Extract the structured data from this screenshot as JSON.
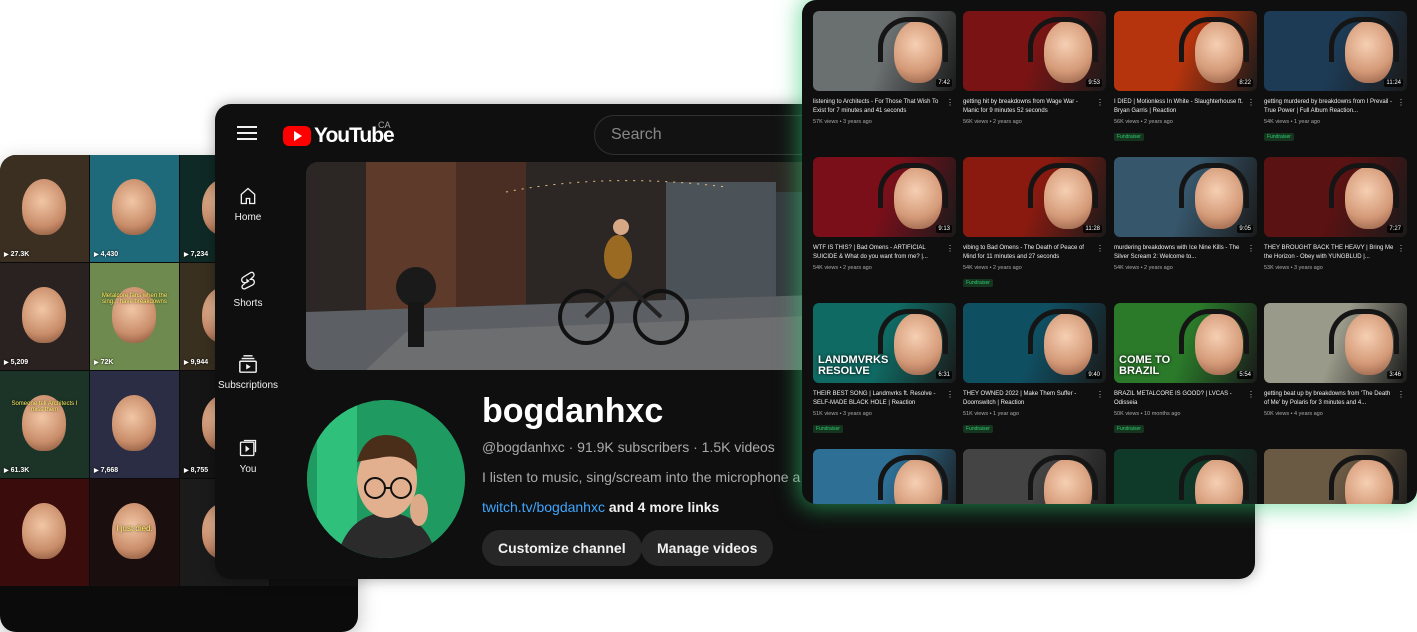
{
  "shorts": {
    "tiles": [
      {
        "views": "27.3K",
        "bg": "#3b2f22"
      },
      {
        "views": "4,430",
        "bg": "#1f6a7a"
      },
      {
        "views": "7,234",
        "bg": "#0f2a26"
      },
      {
        "views": "",
        "bg": "#101010"
      },
      {
        "views": "5,209",
        "bg": "#2a2220"
      },
      {
        "views": "72K",
        "bg": "#6f8a4e",
        "caption": "Metalcore fans when the sing... have breakdowns"
      },
      {
        "views": "9,944",
        "bg": "#3a3020"
      },
      {
        "views": "",
        "bg": "#101010"
      },
      {
        "views": "61.3K",
        "bg": "#1c3328",
        "caption": "Someone tell Architects I miss them"
      },
      {
        "views": "7,668",
        "bg": "#2a2d44"
      },
      {
        "views": "8,755",
        "bg": "#151515"
      },
      {
        "views": "",
        "bg": "#101010"
      },
      {
        "views": "",
        "bg": "#3a0c0c"
      },
      {
        "views": "",
        "bg": "#1a0e0e",
        "caption2": "I just died."
      },
      {
        "views": "",
        "bg": "#1b1b1b"
      },
      {
        "views": "",
        "bg": "#101010"
      }
    ]
  },
  "app": {
    "brand": "YouTube",
    "country_code": "CA",
    "search_placeholder": "Search"
  },
  "sidebar": [
    {
      "label": "Home",
      "icon": "home-icon"
    },
    {
      "label": "Shorts",
      "icon": "shorts-icon"
    },
    {
      "label": "Subscriptions",
      "icon": "subscriptions-icon"
    },
    {
      "label": "You",
      "icon": "you-icon"
    }
  ],
  "channel": {
    "name": "bogdanhxc",
    "meta": "@bogdanhxc · 91.9K subscribers · 1.5K videos",
    "description": "I listen to music, sing/scream into the microphone a",
    "link": "twitch.tv/bogdanhxc",
    "more_links": " and 4 more links",
    "customize_label": "Customize channel",
    "manage_label": "Manage videos"
  },
  "videos": [
    {
      "title": "listening to Architects - For Those That Wish To Exist for 7 minutes and 41 seconds",
      "stats": "57K views • 3 years ago",
      "duration": "7:42",
      "fundraiser": false,
      "color": "#6a6f70"
    },
    {
      "title": "getting hit by breakdowns from Wage War - Manic for 9 minutes 52 seconds",
      "stats": "56K views • 2 years ago",
      "duration": "9:53",
      "fundraiser": false,
      "color": "#7a1414"
    },
    {
      "title": "I DIED | Motionless In White - Slaughterhouse ft. Bryan Garris | Reaction",
      "stats": "56K views • 2 years ago",
      "duration": "8:22",
      "fundraiser": true,
      "color": "#b5340d"
    },
    {
      "title": "getting murdered by breakdowns from I Prevail - True Power | Full Album Reaction...",
      "stats": "54K views • 1 year ago",
      "duration": "11:24",
      "fundraiser": true,
      "color": "#1d3b55"
    },
    {
      "title": "WTF IS THIS? | Bad Omens - ARTIFICIAL SUICIDE & What do you want from me? |...",
      "stats": "54K views • 2 years ago",
      "duration": "9:13",
      "fundraiser": false,
      "color": "#7a0f1a"
    },
    {
      "title": "vibing to Bad Omens - The Death of Peace of Mind for 11 minutes and 27 seconds",
      "stats": "54K views • 2 years ago",
      "duration": "11:28",
      "fundraiser": true,
      "color": "#8a1a10"
    },
    {
      "title": "murdering breakdowns with Ice Nine Kills - The Silver Scream 2: Welcome to...",
      "stats": "54K views • 2 years ago",
      "duration": "9:05",
      "fundraiser": false,
      "color": "#36566b"
    },
    {
      "title": "THEY BROUGHT BACK THE HEAVY | Bring Me the Horizon - Obey with YUNGBLUD |...",
      "stats": "53K views • 3 years ago",
      "duration": "7:27",
      "fundraiser": false,
      "color": "#5a1212"
    },
    {
      "title": "THEIR BEST SONG | Landmvrks ft. Resolve - SELF-MADE BLACK HOLE | Reaction",
      "stats": "51K views • 3 years ago",
      "duration": "6:31",
      "fundraiser": true,
      "color": "#0f6a63",
      "overlay": "LANDMVRKS RESOLVE"
    },
    {
      "title": "THEY OWNED 2022 | Make Them Suffer - Doomswitch | Reaction",
      "stats": "51K views • 1 year ago",
      "duration": "9:40",
      "fundraiser": true,
      "color": "#0f4f62"
    },
    {
      "title": "BRAZIL METALCORE IS GOOD? | LVCAS - Odisseia",
      "stats": "50K views • 10 months ago",
      "duration": "5:54",
      "fundraiser": true,
      "color": "#2a7a2a",
      "overlay": "COME TO BRAZIL"
    },
    {
      "title": "getting beat up by breakdowns from 'The Death of Me' by Polaris for 3 minutes and 4...",
      "stats": "50K views • 4 years ago",
      "duration": "3:46",
      "fundraiser": false,
      "color": "#9a9a8a"
    },
    {
      "title": "",
      "stats": "",
      "duration": "",
      "fundraiser": false,
      "color": "#2e6f95"
    },
    {
      "title": "",
      "stats": "",
      "duration": "",
      "fundraiser": false,
      "color": "#444444"
    },
    {
      "title": "",
      "stats": "",
      "duration": "",
      "fundraiser": false,
      "color": "#0f3a2a"
    },
    {
      "title": "",
      "stats": "",
      "duration": "",
      "fundraiser": false,
      "color": "#6a5a44"
    }
  ],
  "fundraiser_label": "Fundraiser"
}
